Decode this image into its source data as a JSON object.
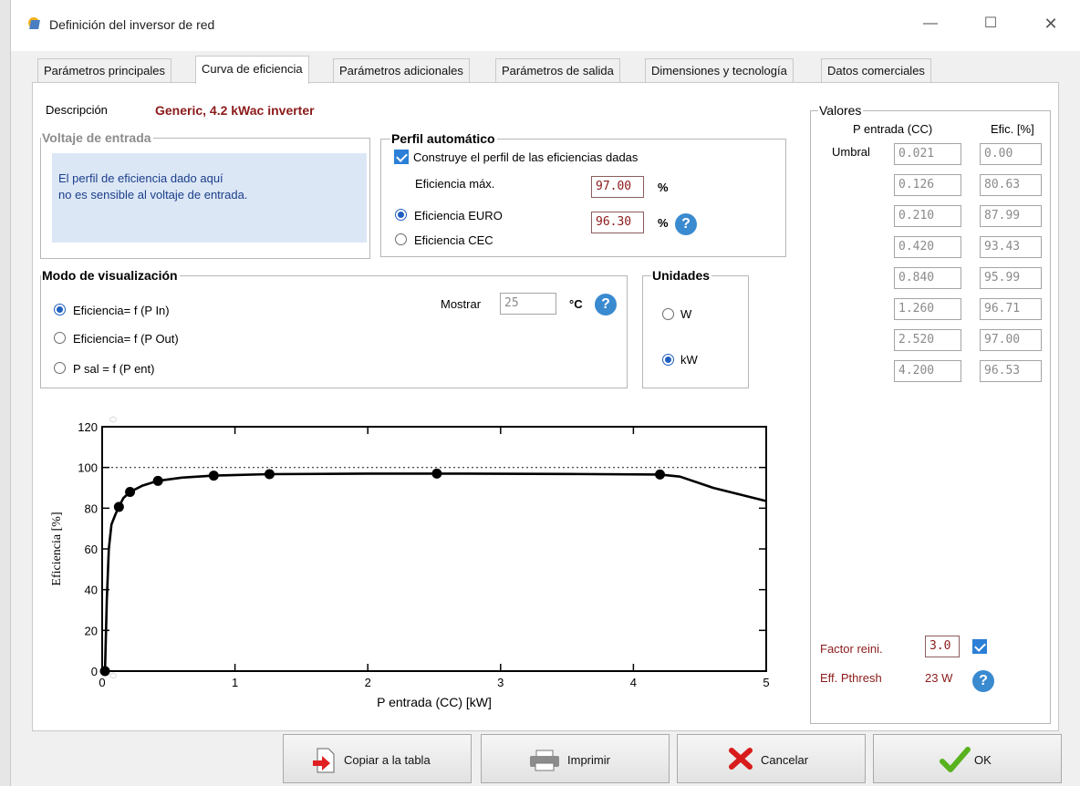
{
  "window": {
    "title": "Definición del inversor de red"
  },
  "tabs": [
    {
      "label": "Parámetros principales"
    },
    {
      "label": "Curva de eficiencia"
    },
    {
      "label": "Parámetros adicionales"
    },
    {
      "label": "Parámetros de salida"
    },
    {
      "label": "Dimensiones y tecnología"
    },
    {
      "label": "Datos comerciales"
    }
  ],
  "description": {
    "label": "Descripción",
    "value": "Generic, 4.2 kWac inverter"
  },
  "voltage_group": {
    "title": "Voltaje de entrada",
    "line1": "El perfil de eficiencia dado aquí",
    "line2": "no es sensible al voltaje de entrada."
  },
  "auto_profile": {
    "title": "Perfil automático",
    "checkbox_label": "Construye el perfil de las eficiencias dadas",
    "max_eff_label": "Eficiencia máx.",
    "max_eff_value": "97.00",
    "max_eff_unit": "%",
    "euro_label": "Eficiencia EURO",
    "euro_value": "96.30",
    "euro_unit": "%",
    "cec_label": "Eficiencia CEC"
  },
  "view_mode": {
    "title": "Modo de visualización",
    "option1": "Eficiencia= f (P In)",
    "option2": "Eficiencia= f (P Out)",
    "option3": "P sal = f (P ent)",
    "show_label": "Mostrar",
    "show_value": "25",
    "show_unit": "°C"
  },
  "units": {
    "title": "Unidades",
    "w": "W",
    "kw": "kW"
  },
  "values": {
    "title": "Valores",
    "col1": "P entrada (CC)",
    "col2": "Efic. [%]",
    "threshold_label": "Umbral",
    "rows": [
      {
        "p": "0.021",
        "eff": "0.00"
      },
      {
        "p": "0.126",
        "eff": "80.63"
      },
      {
        "p": "0.210",
        "eff": "87.99"
      },
      {
        "p": "0.420",
        "eff": "93.43"
      },
      {
        "p": "0.840",
        "eff": "95.99"
      },
      {
        "p": "1.260",
        "eff": "96.71"
      },
      {
        "p": "2.520",
        "eff": "97.00"
      },
      {
        "p": "4.200",
        "eff": "96.53"
      }
    ],
    "factor_label": "Factor reini.",
    "factor_value": "3.0",
    "pthresh_label": "Eff. Pthresh",
    "pthresh_value": "23 W"
  },
  "chart_data": {
    "type": "line",
    "title": "",
    "xlabel": "P entrada (CC) [kW]",
    "ylabel": "Eficiencia [%]",
    "xlim": [
      0,
      5
    ],
    "ylim": [
      0,
      120
    ],
    "xticks": [
      "0",
      "1",
      "2",
      "3",
      "4",
      "5"
    ],
    "yticks": [
      "0",
      "20",
      "40",
      "60",
      "80",
      "100",
      "120"
    ],
    "reference_line": 100,
    "curve": {
      "x": [
        0.0,
        0.021,
        0.035,
        0.05,
        0.07,
        0.1,
        0.126,
        0.16,
        0.21,
        0.3,
        0.42,
        0.6,
        0.84,
        1.26,
        2.0,
        2.52,
        3.5,
        4.2,
        4.35,
        4.6,
        5.0
      ],
      "y": [
        0,
        0,
        35,
        60,
        72,
        77,
        80.63,
        85,
        87.99,
        91,
        93.43,
        95,
        95.99,
        96.71,
        97,
        97,
        96.8,
        96.53,
        95.5,
        90,
        83.5
      ]
    },
    "points": {
      "x": [
        0.021,
        0.126,
        0.21,
        0.42,
        0.84,
        1.26,
        2.52,
        4.2
      ],
      "y": [
        0.0,
        80.63,
        87.99,
        93.43,
        95.99,
        96.71,
        97.0,
        96.53
      ]
    }
  },
  "buttons": {
    "copy": "Copiar a la tabla",
    "print": "Imprimir",
    "cancel": "Cancelar",
    "ok": "OK"
  }
}
